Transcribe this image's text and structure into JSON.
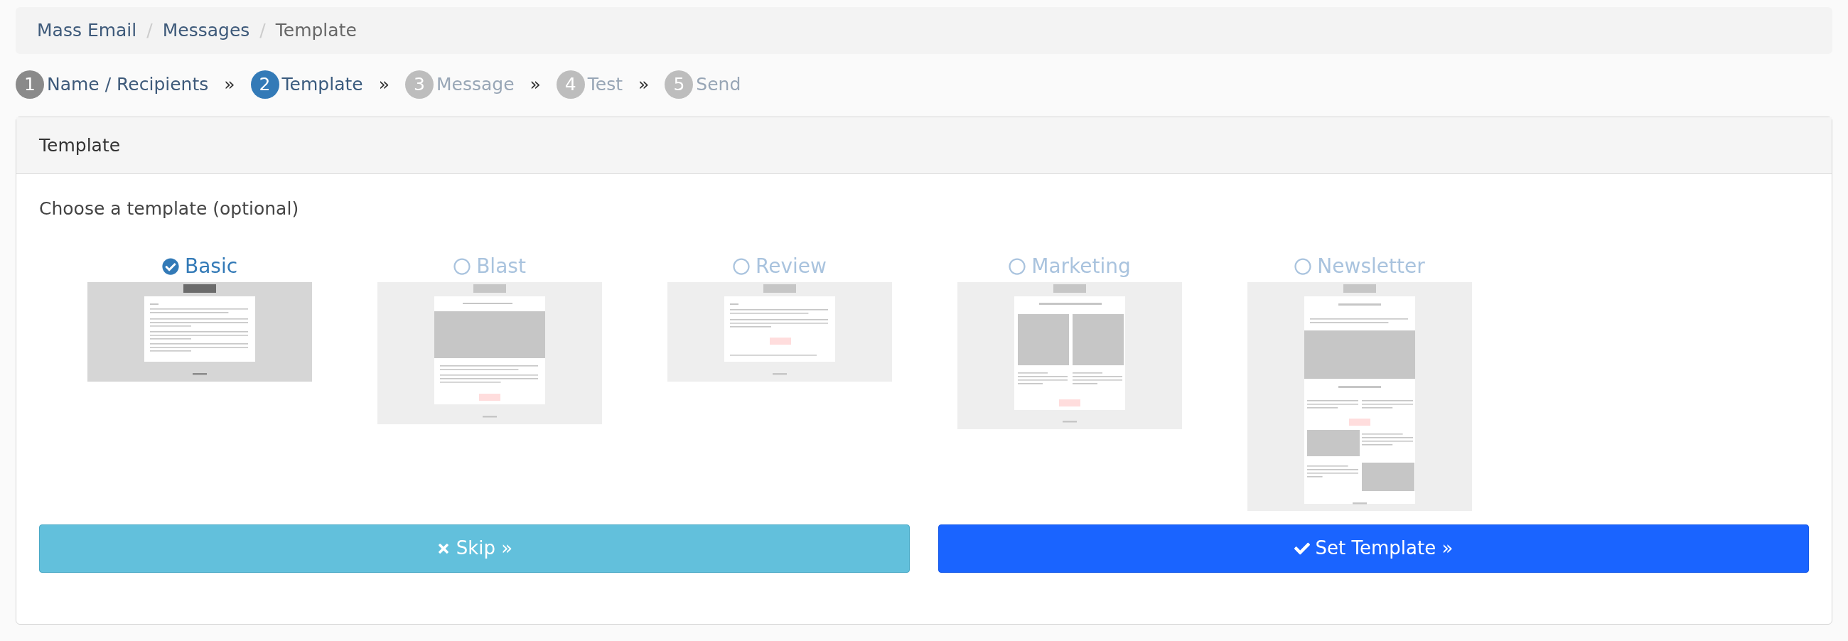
{
  "breadcrumb": [
    {
      "label": "Mass Email",
      "current": false
    },
    {
      "label": "Messages",
      "current": false
    },
    {
      "label": "Template",
      "current": true
    }
  ],
  "breadcrumb_separator": "/",
  "steps": [
    {
      "number": "1",
      "label": "Name / Recipients",
      "completed": true,
      "selected": false
    },
    {
      "number": "2",
      "label": "Template",
      "completed": false,
      "selected": true
    },
    {
      "number": "3",
      "label": "Message",
      "completed": false,
      "selected": false
    },
    {
      "number": "4",
      "label": "Test",
      "completed": false,
      "selected": false
    },
    {
      "number": "5",
      "label": "Send",
      "completed": false,
      "selected": false
    }
  ],
  "step_separator": "»",
  "panel": {
    "title": "Template",
    "prompt": "Choose a template (optional)",
    "templates": [
      {
        "name": "Basic",
        "kind": "basic",
        "selected": true
      },
      {
        "name": "Blast",
        "kind": "blast",
        "selected": false
      },
      {
        "name": "Review",
        "kind": "review",
        "selected": false
      },
      {
        "name": "Marketing",
        "kind": "marketing",
        "selected": false
      },
      {
        "name": "Newsletter",
        "kind": "newsletter",
        "selected": false
      }
    ],
    "buttons": [
      {
        "label": "Skip »",
        "kind": "skip"
      },
      {
        "label": "Set Template »",
        "kind": "set"
      }
    ]
  }
}
